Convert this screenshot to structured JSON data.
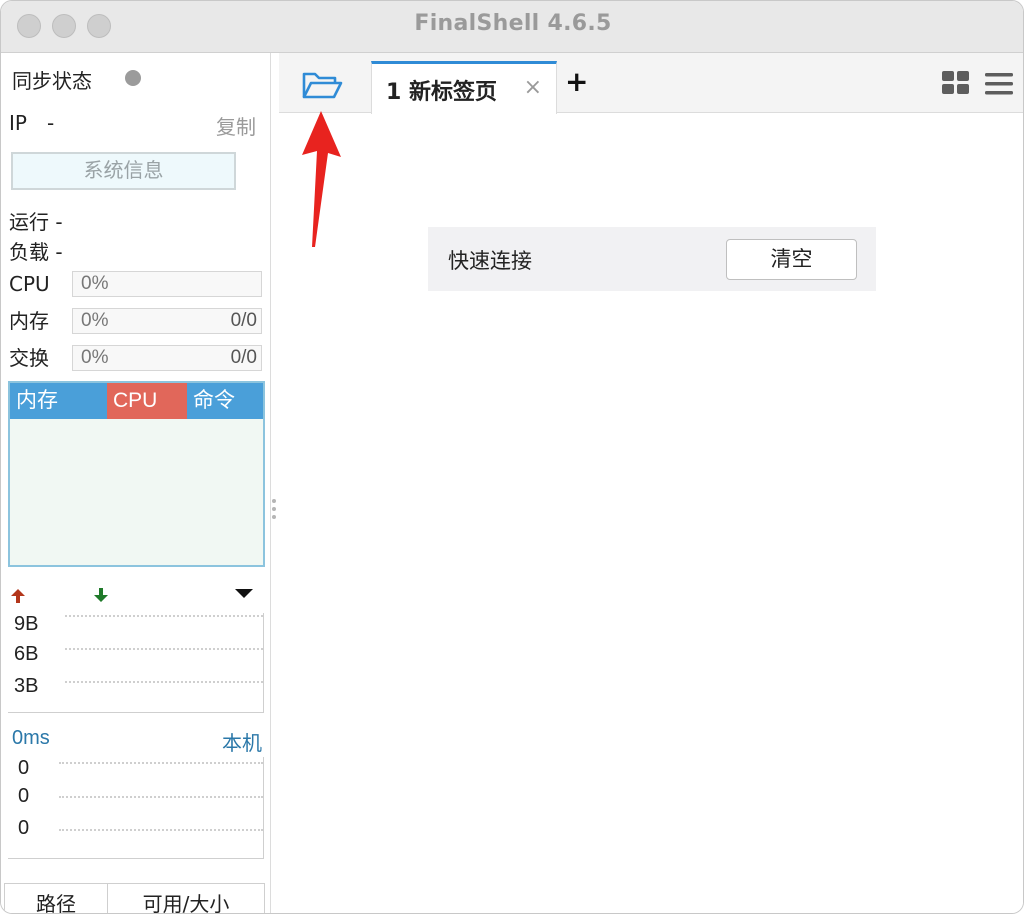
{
  "window": {
    "title": "FinalShell 4.6.5"
  },
  "sidebar": {
    "sync_status_label": "同步状态",
    "ip_label": "IP",
    "ip_value": "-",
    "copy_label": "复制",
    "sysinfo_button": "系统信息",
    "run_label": "运行 -",
    "load_label": "负载 -",
    "meters": [
      {
        "label": "CPU",
        "percent": "0%",
        "ratio": ""
      },
      {
        "label": "内存",
        "percent": "0%",
        "ratio": "0/0"
      },
      {
        "label": "交换",
        "percent": "0%",
        "ratio": "0/0"
      }
    ],
    "process_tabs": {
      "memory": "内存",
      "cpu": "CPU",
      "command": "命令"
    },
    "network": {
      "up_icon": "arrow-up-icon",
      "down_icon": "arrow-down-icon",
      "ticks": [
        "9B",
        "6B",
        "3B"
      ]
    },
    "ping": {
      "latency": "0ms",
      "host": "本机",
      "ticks": [
        "0",
        "0",
        "0"
      ]
    },
    "disk_table": {
      "col_path": "路径",
      "col_size": "可用/大小"
    }
  },
  "tabs": {
    "folder_icon": "folder-open-icon",
    "active_tab": "1 新标签页",
    "close_symbol": "×",
    "add_symbol": "+",
    "grid_icon": "grid-view-icon",
    "menu_icon": "hamburger-menu-icon"
  },
  "main": {
    "quick_connect_label": "快速连接",
    "clear_button": "清空"
  },
  "colors": {
    "tab_accent": "#2f8bd6",
    "process_header_blue": "#4a9fd9",
    "process_header_red": "#e1675a",
    "ping_text": "#2b78a9",
    "annotation_arrow": "#e8231f"
  }
}
